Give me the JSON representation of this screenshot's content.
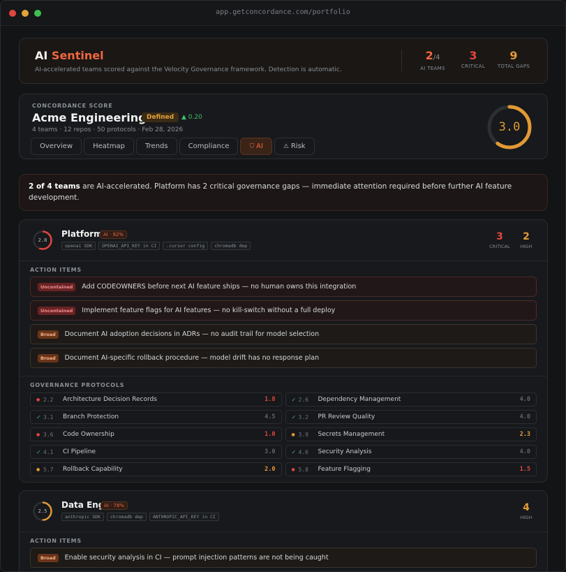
{
  "window": {
    "url": "app.getconcordance.com/portfolio",
    "dot_colors": [
      "#e2463f",
      "#e2a33a",
      "#3fbf4f"
    ]
  },
  "sentinel": {
    "title_a": "AI",
    "title_b": "Sentinel",
    "subtitle": "AI-accelerated teams scored against the Velocity Governance framework. Detection is automatic.",
    "stats": [
      {
        "value": "2",
        "denominator": "/4",
        "label": "AI TEAMS",
        "color": "#f0663f"
      },
      {
        "value": "3",
        "denominator": "",
        "label": "CRITICAL",
        "color": "#e2463f"
      },
      {
        "value": "9",
        "denominator": "",
        "label": "TOTAL GAPS",
        "color": "#e29a35"
      }
    ]
  },
  "score": {
    "label": "CONCORDANCE SCORE",
    "org": "Acme Engineering",
    "maturity": "Defined",
    "delta": "▲ 0.20",
    "meta": "4 teams · 12 repos · 50 protocols · Feb 28, 2026",
    "value": "3.0",
    "fraction": 0.6,
    "tabs": [
      {
        "label": "Overview",
        "icon": ""
      },
      {
        "label": "Heatmap",
        "icon": ""
      },
      {
        "label": "Trends",
        "icon": ""
      },
      {
        "label": "Compliance",
        "icon": ""
      },
      {
        "label": "AI",
        "icon": "shield-icon",
        "glyph": "⛉"
      },
      {
        "label": "Risk",
        "icon": "warning-icon",
        "glyph": "⚠"
      }
    ],
    "active_tab": "AI"
  },
  "alert": {
    "bold": "2 of 4 teams",
    "text": " are AI-accelerated. Platform has 2 critical governance gaps — immediate attention required before further AI feature development."
  },
  "teams": [
    {
      "name": "Platform",
      "score": "2.8",
      "score_fraction": 0.56,
      "ring_color": "#e2463f",
      "ai": "AI · 92%",
      "chips": [
        "openai SDK",
        "OPENAI_API_KEY in CI",
        ".cursor config",
        "chromadb dep"
      ],
      "counts": [
        {
          "value": "3",
          "label": "CRITICAL",
          "color": "#e2463f"
        },
        {
          "value": "2",
          "label": "HIGH",
          "color": "#e29a35"
        }
      ],
      "action_label": "ACTION ITEMS",
      "actions": [
        {
          "tag": "Uncontained",
          "kind": "unc",
          "text": "Add CODEOWNERS before next AI feature ships — no human owns this integration"
        },
        {
          "tag": "Uncontained",
          "kind": "unc",
          "text": "Implement feature flags for AI features — no kill-switch without a full deploy"
        },
        {
          "tag": "Broad",
          "kind": "broad",
          "text": "Document AI adoption decisions in ADRs — no audit trail for model selection"
        },
        {
          "tag": "Broad",
          "kind": "broad",
          "text": "Document AI-specific rollback procedure — model drift has no response plan"
        }
      ],
      "protocols_label": "GOVERNANCE PROTOCOLS",
      "protocols": [
        {
          "status": "red",
          "score": "2.2",
          "name": "Architecture Decision Records",
          "target": "1.8",
          "tcolor": "#e2463f"
        },
        {
          "status": "check",
          "score": "2.6",
          "name": "Dependency Management",
          "target": "4.0",
          "tcolor": "#5f646b"
        },
        {
          "status": "check",
          "score": "3.1",
          "name": "Branch Protection",
          "target": "4.5",
          "tcolor": "#5f646b"
        },
        {
          "status": "check",
          "score": "3.2",
          "name": "PR Review Quality",
          "target": "4.0",
          "tcolor": "#5f646b"
        },
        {
          "status": "red",
          "score": "3.6",
          "name": "Code Ownership",
          "target": "1.0",
          "tcolor": "#e2463f"
        },
        {
          "status": "amber",
          "score": "3.9",
          "name": "Secrets Management",
          "target": "2.3",
          "tcolor": "#e29a35"
        },
        {
          "status": "check",
          "score": "4.1",
          "name": "CI Pipeline",
          "target": "3.0",
          "tcolor": "#5f646b"
        },
        {
          "status": "check",
          "score": "4.6",
          "name": "Security Analysis",
          "target": "4.0",
          "tcolor": "#5f646b"
        },
        {
          "status": "amber",
          "score": "5.7",
          "name": "Rollback Capability",
          "target": "2.0",
          "tcolor": "#e29a35"
        },
        {
          "status": "red",
          "score": "5.8",
          "name": "Feature Flagging",
          "target": "1.5",
          "tcolor": "#e2463f"
        }
      ]
    },
    {
      "name": "Data Eng",
      "score": "2.5",
      "score_fraction": 0.5,
      "ring_color": "#e29a35",
      "ai": "AI · 78%",
      "chips": [
        "anthropic SDK",
        "chromadb dep",
        "ANTHROPIC_API_KEY in CI"
      ],
      "counts": [
        {
          "value": "4",
          "label": "HIGH",
          "color": "#e29a35"
        }
      ],
      "action_label": "ACTION ITEMS",
      "actions": [
        {
          "tag": "Broad",
          "kind": "broad",
          "text": "Enable security analysis in CI — prompt injection patterns are not being caught"
        }
      ]
    }
  ]
}
